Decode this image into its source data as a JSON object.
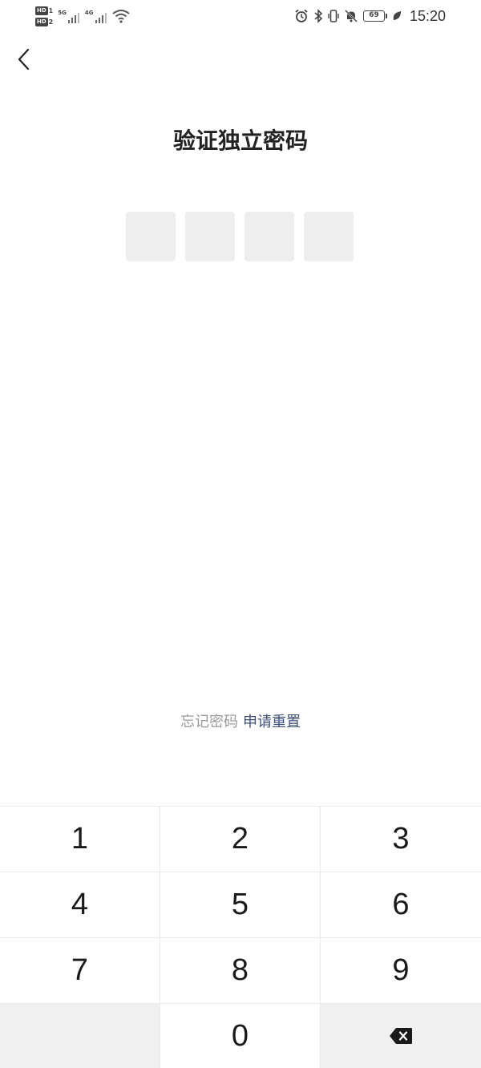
{
  "status_bar": {
    "sim1_badge": "HD",
    "sim1_number": "1",
    "sim2_badge": "HD",
    "sim2_number": "2",
    "network1": "5G",
    "network2": "4G",
    "battery_level": "69",
    "time": "15:20"
  },
  "header": {
    "title": "验证独立密码"
  },
  "pin": {
    "length": 4
  },
  "footer": {
    "forgot_text": "忘记密码",
    "reset_link": "申请重置"
  },
  "keypad": {
    "keys": [
      "1",
      "2",
      "3",
      "4",
      "5",
      "6",
      "7",
      "8",
      "9",
      "0"
    ]
  },
  "colors": {
    "accent": "#3c4f7a",
    "pin_box": "#eeeeee",
    "key_gray": "#f0f0f0"
  }
}
